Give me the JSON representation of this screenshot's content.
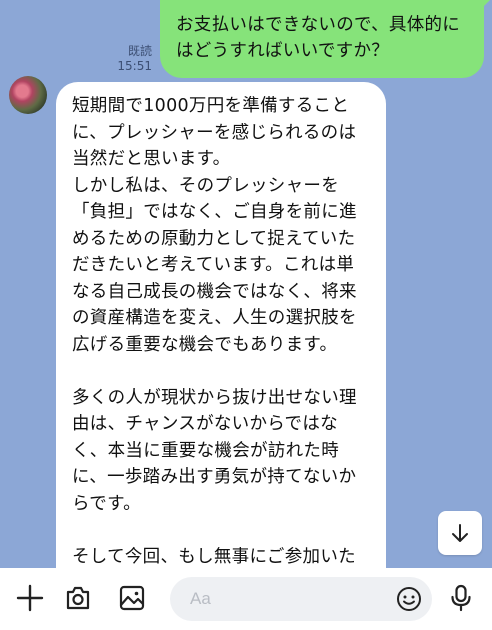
{
  "conversation": {
    "sent": {
      "read_label": "既読",
      "time": "15:51",
      "text": "お支払いはできないので、具体的にはどうすればいいですか？"
    },
    "received": {
      "text": "短期間で1000万円を準備することに、プレッシャーを感じられるのは当然だと思います。\nしかし私は、そのプレッシャーを「負担」ではなく、ご自身を前に進めるための原動力として捉えていただきたいと考えています。これは単なる自己成長の機会ではなく、将来の資産構造を変え、人生の選択肢を広げる重要な機会でもあります。\n\n多くの人が現状から抜け出せない理由は、チャンスがないからではなく、本当に重要な機会が訪れた時に、一歩踏み出す勇気が持てないからです。\n\nそして今回、もし無事にご参加いただければ、得られるのは単なる"
    }
  },
  "input_bar": {
    "placeholder": "Aa",
    "icons": [
      "plus-icon",
      "camera-icon",
      "image-icon",
      "emoji-icon",
      "microphone-icon"
    ]
  },
  "colors": {
    "chat_background": "#8ca7d6",
    "sent_bubble": "#86e37a",
    "received_bubble": "#ffffff"
  }
}
